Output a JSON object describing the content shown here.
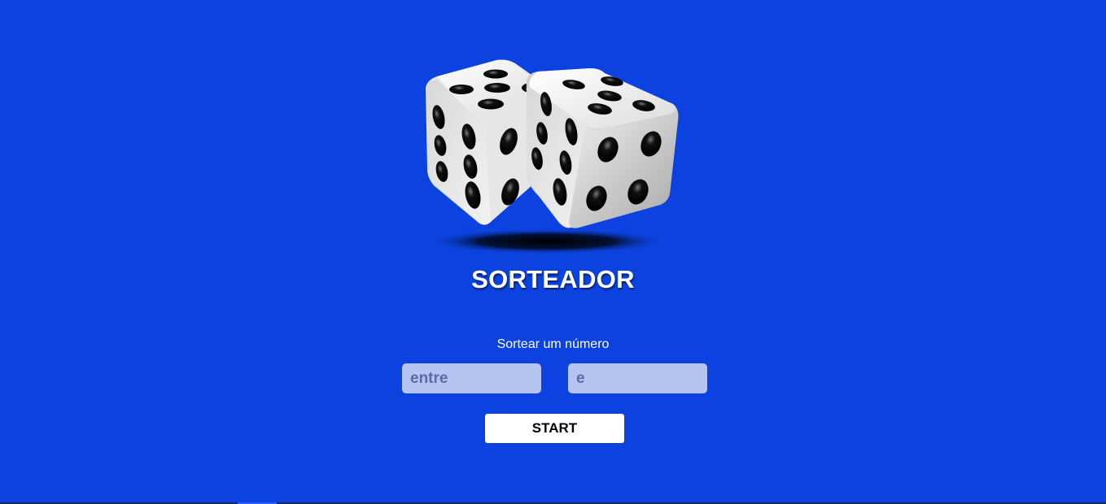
{
  "app": {
    "title": "SORTEADOR",
    "subtitle": "Sortear um número"
  },
  "form": {
    "min_field": {
      "placeholder": "entre",
      "value": ""
    },
    "max_field": {
      "placeholder": "e",
      "value": ""
    },
    "start_label": "START"
  },
  "colors": {
    "background": "#0c43e0",
    "input_background": "#b6c4f2",
    "button_background": "#ffffff",
    "title_text": "#ffffff"
  },
  "icons": {
    "hero": "dice-icon"
  }
}
